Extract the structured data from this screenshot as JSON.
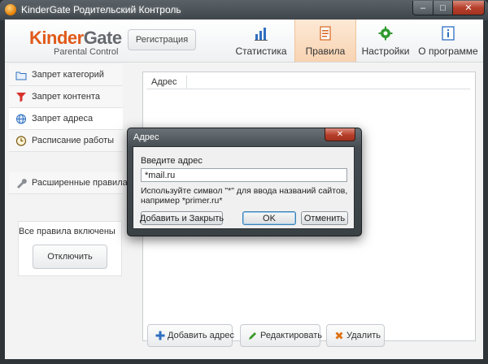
{
  "window": {
    "title": "KinderGate Родительский Контроль",
    "controls": {
      "minimize": "–",
      "maximize": "□",
      "close": "✕"
    }
  },
  "header": {
    "logo": {
      "kinder": "Kinder",
      "gate": "Gate",
      "subtitle": "Parental Control"
    },
    "register_label": "Регистрация",
    "tabs": [
      {
        "label": "Статистика",
        "icon": "bar-chart-icon"
      },
      {
        "label": "Правила",
        "icon": "rules-document-icon",
        "active": true
      },
      {
        "label": "Настройки",
        "icon": "gear-icon"
      },
      {
        "label": "О программе",
        "icon": "info-icon"
      }
    ]
  },
  "sidebar": {
    "items": [
      {
        "label": "Запрет категорий",
        "icon": "folder-icon"
      },
      {
        "label": "Запрет контента",
        "icon": "filter-icon"
      },
      {
        "label": "Запрет адреса",
        "icon": "globe-icon",
        "active": true
      },
      {
        "label": "Расписание работы",
        "icon": "clock-icon"
      },
      {
        "label": "Расширенные правила",
        "icon": "wrench-icon"
      }
    ],
    "status_text": "Все правила включены",
    "disable_label": "Отключить"
  },
  "content": {
    "column_header": "Адрес",
    "actions": {
      "add": "Добавить адрес",
      "edit": "Редактировать",
      "delete": "Удалить"
    }
  },
  "dialog": {
    "title": "Адрес",
    "close": "✕",
    "prompt": "Введите адрес",
    "input_value": "*mail.ru",
    "hint": "Используйте символ \"*\" для ввода названий сайтов, например *primer.ru*",
    "buttons": {
      "add_close": "Добавить и Закрыть",
      "ok": "OK",
      "cancel": "Отменить"
    }
  },
  "colors": {
    "accent_orange": "#e05a1a",
    "active_tab_bg": "#f8d3b2",
    "add_icon_blue": "#2f6fc0",
    "edit_icon_green": "#3a9a2a",
    "delete_icon_orange": "#e07010"
  }
}
